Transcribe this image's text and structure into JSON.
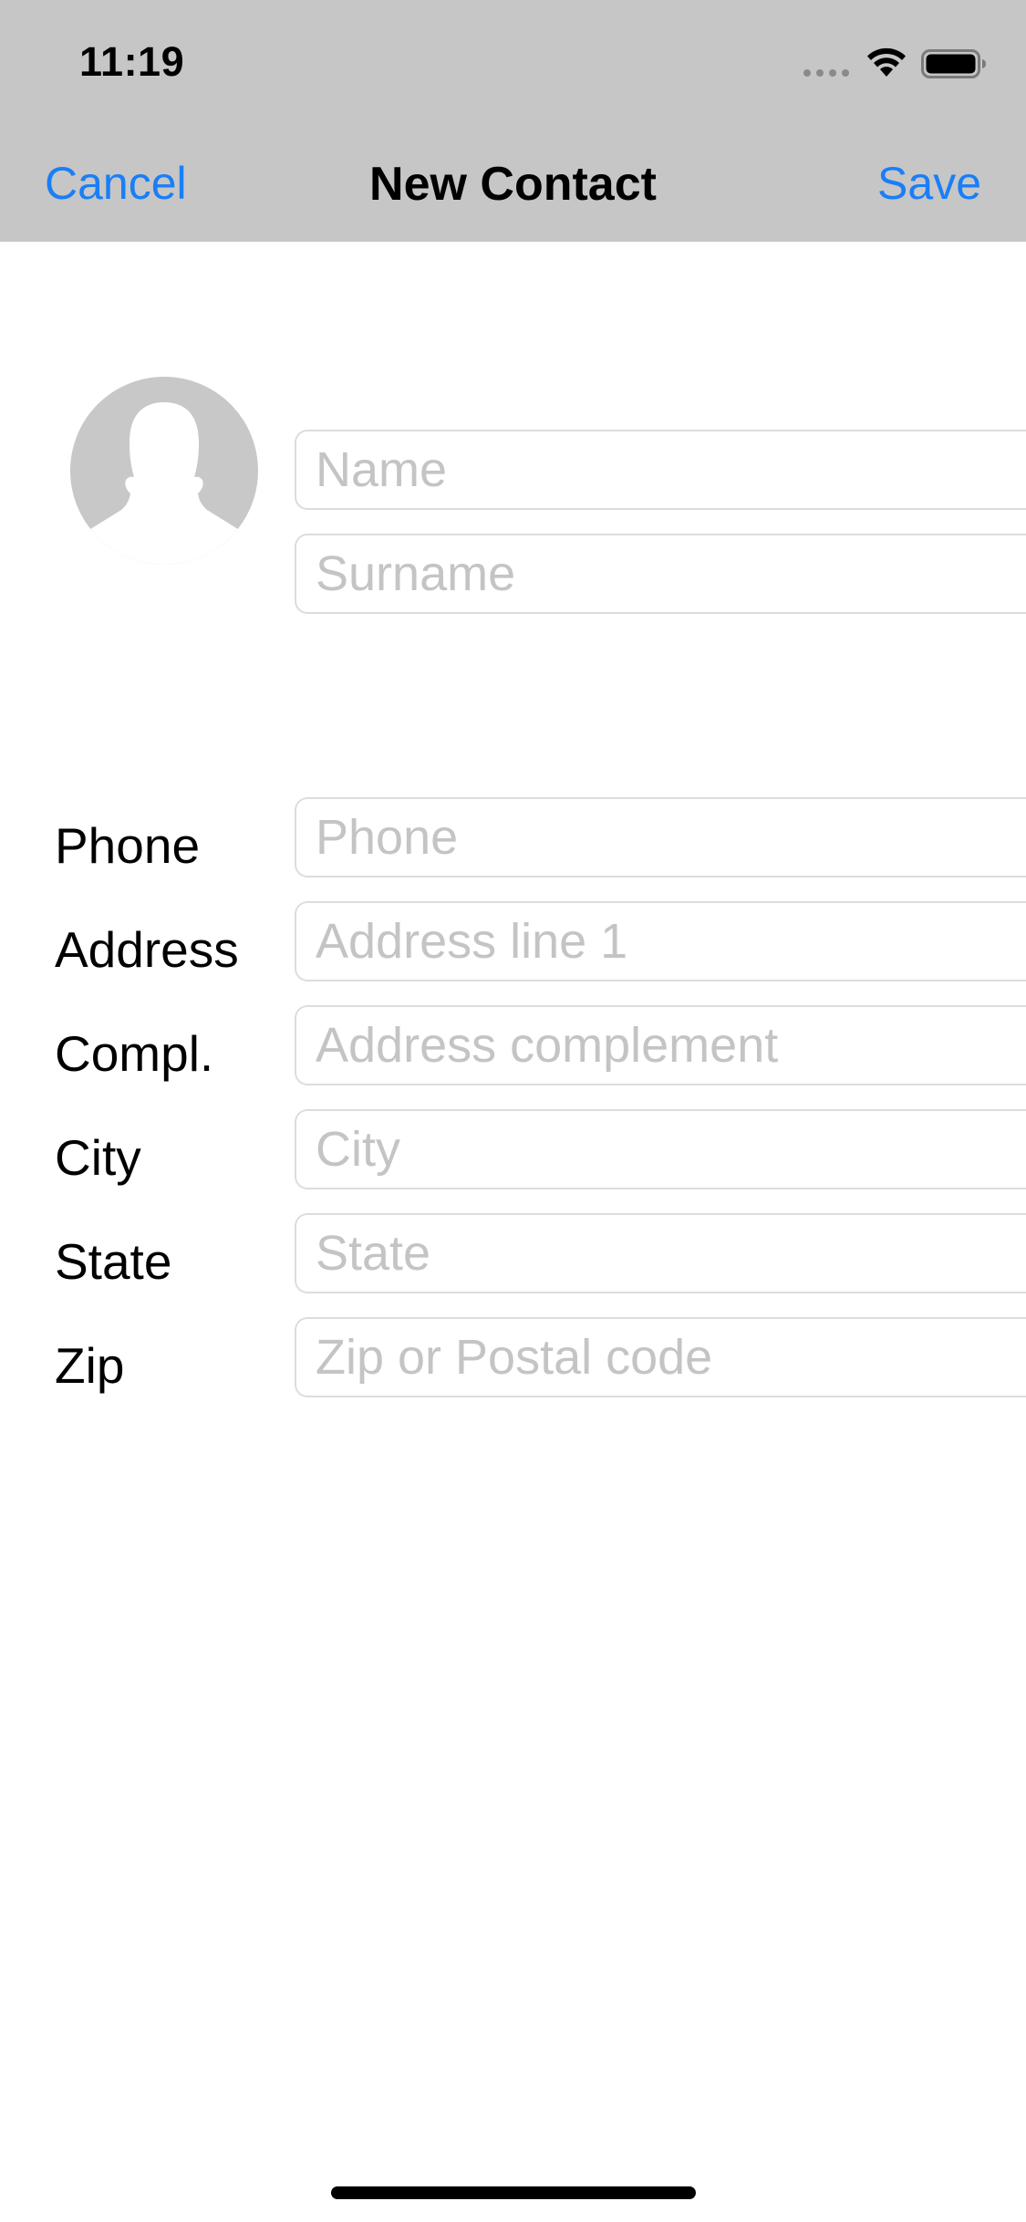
{
  "status_bar": {
    "time": "11:19"
  },
  "nav": {
    "cancel_label": "Cancel",
    "title": "New Contact",
    "save_label": "Save",
    "accent_color": "#1a7ef7",
    "background_color": "#c6c6c6"
  },
  "avatar": {
    "icon": "person-silhouette-icon"
  },
  "name_fields": {
    "name": {
      "value": "",
      "placeholder": "Name"
    },
    "surname": {
      "value": "",
      "placeholder": "Surname"
    }
  },
  "form": {
    "phone": {
      "label": "Phone",
      "value": "",
      "placeholder": "Phone"
    },
    "address": {
      "label": "Address",
      "value": "",
      "placeholder": "Address line 1"
    },
    "complement": {
      "label": "Compl.",
      "value": "",
      "placeholder": "Address complement"
    },
    "city": {
      "label": "City",
      "value": "",
      "placeholder": "City"
    },
    "state": {
      "label": "State",
      "value": "",
      "placeholder": "State"
    },
    "zip": {
      "label": "Zip",
      "value": "",
      "placeholder": "Zip or Postal code"
    }
  }
}
